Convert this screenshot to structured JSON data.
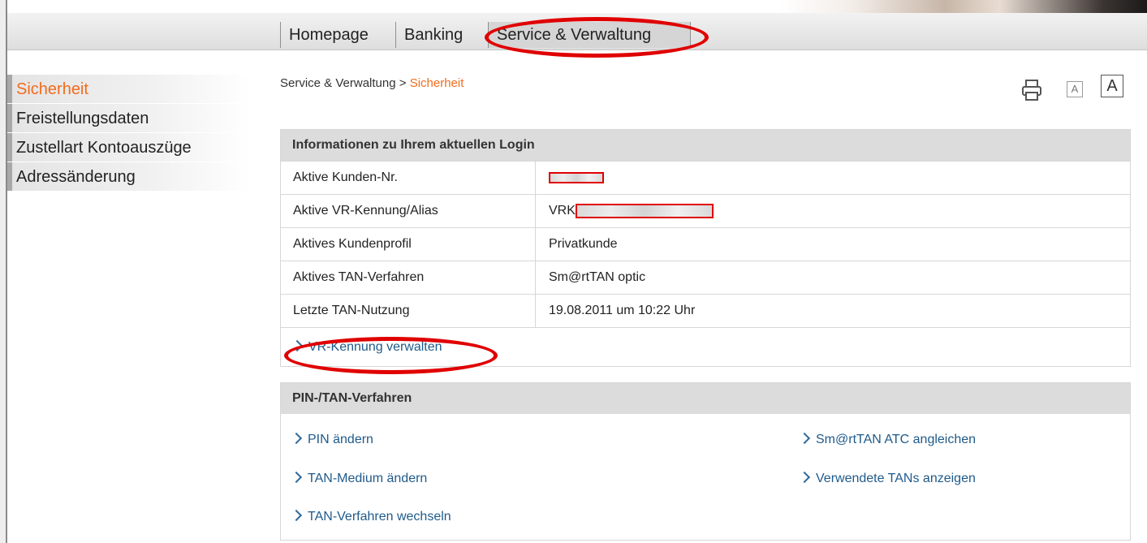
{
  "nav": {
    "tabs": [
      {
        "label": "Homepage"
      },
      {
        "label": "Banking"
      },
      {
        "label": "Service & Verwaltung"
      }
    ]
  },
  "sidebar": {
    "items": [
      {
        "label": "Sicherheit",
        "active": true
      },
      {
        "label": "Freistellungsdaten"
      },
      {
        "label": "Zustellart Kontoauszüge"
      },
      {
        "label": "Adressänderung"
      }
    ]
  },
  "breadcrumb": {
    "parent": "Service & Verwaltung",
    "separator": " > ",
    "current": "Sicherheit"
  },
  "tools": {
    "print_icon": "printer-icon",
    "font_small": "A",
    "font_large": "A"
  },
  "login_panel": {
    "title": "Informationen zu Ihrem aktuellen Login",
    "rows": [
      {
        "label": "Aktive Kunden-Nr.",
        "value": ""
      },
      {
        "label": "Aktive VR-Kennung/Alias",
        "value": "VRK"
      },
      {
        "label": "Aktives Kundenprofil",
        "value": "Privatkunde"
      },
      {
        "label": "Aktives TAN-Verfahren",
        "value": "Sm@rtTAN optic"
      },
      {
        "label": "Letzte TAN-Nutzung",
        "value": "19.08.2011 um 10:22 Uhr"
      }
    ],
    "link": "VR-Kennung verwalten"
  },
  "pin_panel": {
    "title": "PIN-/TAN-Verfahren",
    "links_left": [
      "PIN ändern",
      "TAN-Medium ändern",
      "TAN-Verfahren wechseln"
    ],
    "links_right": [
      "Sm@rtTAN ATC angleichen",
      "Verwendete TANs anzeigen"
    ]
  },
  "colors": {
    "accent": "#f26b1d",
    "link": "#1f5a8a",
    "highlight_ellipse": "#e00000"
  }
}
